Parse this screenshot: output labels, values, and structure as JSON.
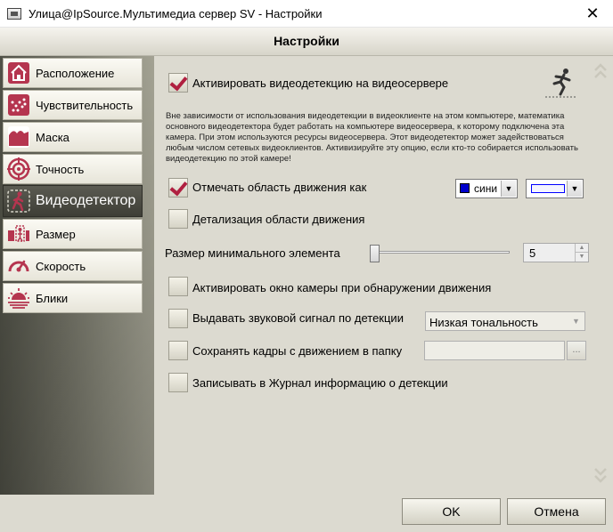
{
  "window": {
    "title": "Улица@IpSource.Мультимедиа сервер SV - Настройки",
    "close_label": "✕"
  },
  "header": {
    "title": "Настройки"
  },
  "sidebar": {
    "items": [
      {
        "label": "Расположение",
        "icon": "house-icon"
      },
      {
        "label": "Чувствительность",
        "icon": "sensitivity-dots-icon"
      },
      {
        "label": "Маска",
        "icon": "mask-icon"
      },
      {
        "label": "Точность",
        "icon": "target-icon"
      },
      {
        "label": "Видеодетектор",
        "icon": "walking-person-icon",
        "active": true
      },
      {
        "label": "Размер",
        "icon": "size-icon"
      },
      {
        "label": "Скорость",
        "icon": "speedometer-icon"
      },
      {
        "label": "Блики",
        "icon": "sun-glare-icon"
      }
    ]
  },
  "main": {
    "activate_detection": {
      "label": "Активировать видеодетекцию на видеосервере",
      "checked": true
    },
    "description": "Вне зависимости от использования видеодетекции в видеоклиенте на этом компьютере, математика основного видеодетектора будет работать на компьютере видеосервера, к которому подключена эта камера. При этом используются ресурсы видеосервера. Этот видеодетектор может задействоваться любым числом сетевых видеоклиентов. Активизируйте эту опцию, если кто-то собирается использовать видеодетекцию по этой камере!",
    "mark_motion": {
      "label": "Отмечать область движения как",
      "checked": true
    },
    "mark_color": {
      "value": "сини",
      "swatch": "#0000cc"
    },
    "mark_style": {
      "line_color": "#0000ff"
    },
    "detail_motion": {
      "label": "Детализация области движения",
      "checked": false
    },
    "min_size": {
      "label": "Размер минимального элемента",
      "value": "5",
      "slider_fraction": 0.0
    },
    "activate_window": {
      "label": "Активировать окно камеры при обнаружении движения",
      "checked": false
    },
    "beep": {
      "label": "Выдавать звуковой сигнал по детекции",
      "checked": false,
      "tone": "Низкая тональность"
    },
    "save_frames": {
      "label": "Сохранять кадры с движением в папку",
      "checked": false,
      "path": "",
      "browse_label": "..."
    },
    "journal": {
      "label": "Записывать в Журнал информацию о детекции",
      "checked": false
    }
  },
  "footer": {
    "ok_label": "OK",
    "cancel_label": "Отмена"
  },
  "colors": {
    "accent": "#b02040",
    "sidebar_dark": "#4f5046"
  }
}
